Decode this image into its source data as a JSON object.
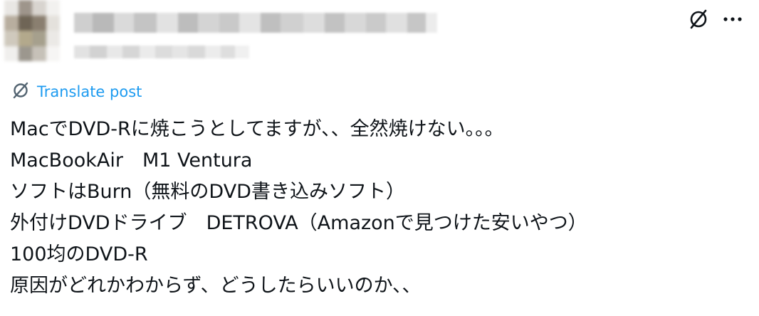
{
  "header": {
    "more_icon": "more-horizontal-icon",
    "translate_icon": "globe-slash-icon"
  },
  "translate": {
    "label": "Translate post",
    "icon": "globe-slash-icon"
  },
  "post": {
    "lines": [
      "MacでDVD-Rに焼こうとしてますが、、全然焼けない。。。",
      "MacBookAir　M1 Ventura",
      "ソフトはBurn（無料のDVD書き込みソフト）",
      "外付けDVDドライブ　DETROVA（Amazonで見つけた安いやつ）",
      "100均のDVD-R",
      "原因がどれかわからず、どうしたらいいのか、、"
    ]
  },
  "colors": {
    "text": "#0f1419",
    "link": "#1d9bf0",
    "icon": "#0f1419",
    "background": "#ffffff"
  }
}
